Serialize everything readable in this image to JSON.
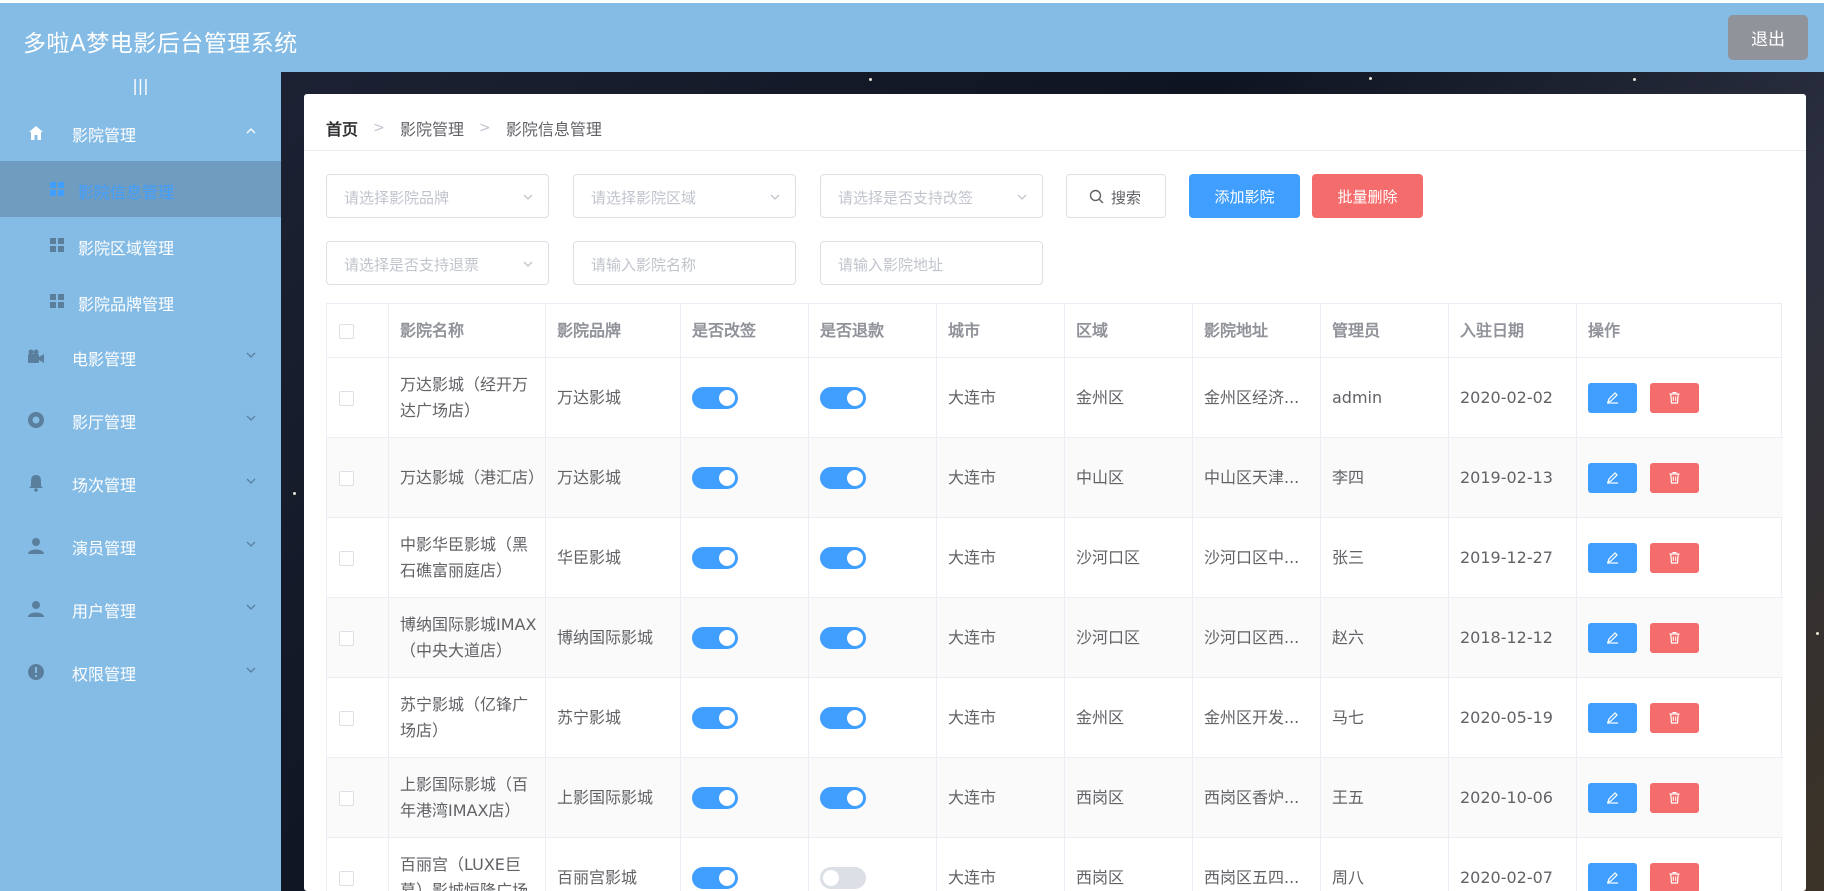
{
  "app": {
    "title": "多啦A梦电影后台管理系统",
    "logout_label": "退出"
  },
  "sidebar": {
    "collapse_icon": "|||",
    "menus": [
      {
        "label": "影院管理",
        "icon": "home-icon",
        "expanded": true,
        "children": [
          {
            "label": "影院信息管理",
            "active": true
          },
          {
            "label": "影院区域管理",
            "active": false
          },
          {
            "label": "影院品牌管理",
            "active": false
          }
        ]
      },
      {
        "label": "电影管理",
        "icon": "video-camera-icon"
      },
      {
        "label": "影厅管理",
        "icon": "help-icon"
      },
      {
        "label": "场次管理",
        "icon": "bell-icon"
      },
      {
        "label": "演员管理",
        "icon": "user-icon"
      },
      {
        "label": "用户管理",
        "icon": "user-icon"
      },
      {
        "label": "权限管理",
        "icon": "warning-icon"
      }
    ]
  },
  "breadcrumb": {
    "home": "首页",
    "level1": "影院管理",
    "level2": "影院信息管理"
  },
  "filters": {
    "brand_placeholder": "请选择影院品牌",
    "area_placeholder": "请选择影院区域",
    "change_placeholder": "请选择是否支持改签",
    "refund_placeholder": "请选择是否支持退票",
    "name_placeholder": "请输入影院名称",
    "address_placeholder": "请输入影院地址"
  },
  "actions": {
    "search_label": "搜索",
    "add_label": "添加影院",
    "batch_delete_label": "批量删除"
  },
  "table": {
    "columns": [
      "影院名称",
      "影院品牌",
      "是否改签",
      "是否退款",
      "城市",
      "区域",
      "影院地址",
      "管理员",
      "入驻日期",
      "操作"
    ],
    "rows": [
      {
        "name": "万达影城（经开万达广场店）",
        "brand": "万达影城",
        "change": true,
        "refund": true,
        "city": "大连市",
        "area": "金州区",
        "address": "金州区经济...",
        "admin": "admin",
        "date": "2020-02-02"
      },
      {
        "name": "万达影城（港汇店）",
        "brand": "万达影城",
        "change": true,
        "refund": true,
        "city": "大连市",
        "area": "中山区",
        "address": "中山区天津...",
        "admin": "李四",
        "date": "2019-02-13"
      },
      {
        "name": "中影华臣影城（黑石礁富丽庭店）",
        "brand": "华臣影城",
        "change": true,
        "refund": true,
        "city": "大连市",
        "area": "沙河口区",
        "address": "沙河口区中...",
        "admin": "张三",
        "date": "2019-12-27"
      },
      {
        "name": "博纳国际影城IMAX（中央大道店）",
        "brand": "博纳国际影城",
        "change": true,
        "refund": true,
        "city": "大连市",
        "area": "沙河口区",
        "address": "沙河口区西...",
        "admin": "赵六",
        "date": "2018-12-12"
      },
      {
        "name": "苏宁影城（亿锋广场店）",
        "brand": "苏宁影城",
        "change": true,
        "refund": true,
        "city": "大连市",
        "area": "金州区",
        "address": "金州区开发...",
        "admin": "马七",
        "date": "2020-05-19"
      },
      {
        "name": "上影国际影城（百年港湾IMAX店）",
        "brand": "上影国际影城",
        "change": true,
        "refund": true,
        "city": "大连市",
        "area": "西岗区",
        "address": "西岗区香炉...",
        "admin": "王五",
        "date": "2020-10-06"
      },
      {
        "name": "百丽宫（LUXE巨幕）影城恒隆广场",
        "brand": "百丽宫影城",
        "change": true,
        "refund": false,
        "city": "大连市",
        "area": "西岗区",
        "address": "西岗区五四...",
        "admin": "周八",
        "date": "2020-02-07"
      }
    ]
  },
  "colors": {
    "header_bg": "#85bce6",
    "primary": "#409eff",
    "danger": "#f56c6c",
    "neutral": "#909399"
  }
}
